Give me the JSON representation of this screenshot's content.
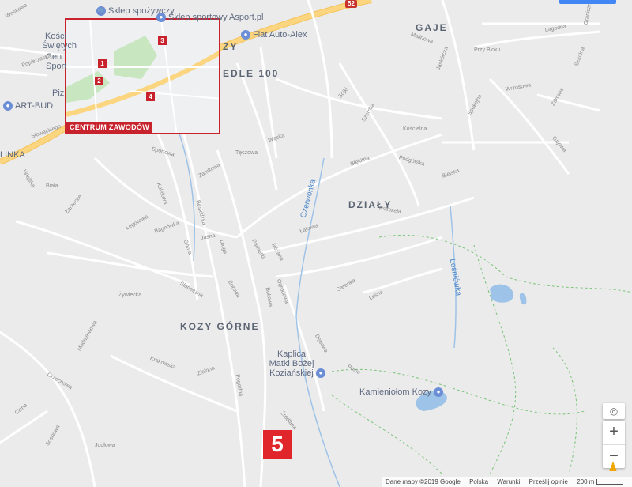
{
  "pois": [
    {
      "label": "Sklep spożywczy",
      "icon": "shopping-cart-icon"
    },
    {
      "label": "Sklep sportowy Asport.pl",
      "icon": "shopping-bag-icon"
    },
    {
      "label": "Fiat Auto-Alex",
      "icon": "car-icon"
    },
    {
      "label": "ART-BUD",
      "icon": "store-icon"
    },
    {
      "label": "Kaplica Matki Bożej Koziańskiej",
      "icon": "church-icon"
    },
    {
      "label": "Kamieniołom Kozy",
      "icon": "landmark-icon"
    }
  ],
  "partial_labels": {
    "kosc": "Kości",
    "swietych": "Świętych",
    "cen": "Cen",
    "sport": "Sport",
    "piz": "Piz",
    "linka": "LINKA",
    "zy": "ZY"
  },
  "areas": {
    "gaje": "GAJE",
    "osiedle": "EDLE 100",
    "dzialy": "DZIAŁY",
    "kozy_gorne": "KOZY GÓRNE"
  },
  "streams": {
    "czerwonka": "Czerwonka",
    "lesniowka": "Leśniówka"
  },
  "road_shield": "52",
  "streets": [
    "Woskowa",
    "Popierzaska",
    "Słowackiego",
    "Wiejska",
    "Biała",
    "Zarzecze",
    "Łęgowska",
    "Bagnówka",
    "Górna",
    "Słoneczna",
    "Sportowa",
    "Kolejowa",
    "Zamkowa",
    "Beskidzka",
    "Jasna",
    "Długa",
    "Wąska",
    "Tęczowa",
    "Pamiętki",
    "Różana",
    "Ogrodowa",
    "Bukowa",
    "Borowa",
    "Źródlana",
    "Leśna",
    "Sarenka",
    "Podgórska",
    "Błękitna",
    "Jaskółcza",
    "Lagodna",
    "Graniczna",
    "Zdrowia",
    "Spokojna",
    "Wrzosowa",
    "Malinowa",
    "Szeroka",
    "Przy Bloku",
    "Gajowa",
    "Sójki",
    "Łąkowa",
    "Pszczela",
    "Bielska",
    "Żywiecka",
    "Modrzewiowa",
    "Orzechowa",
    "Krakowska",
    "Zielona",
    "Pogodna",
    "Cicha",
    "Sosnowa",
    "Jodłowa",
    "Dębowa",
    "Polna",
    "Kościelna",
    "Szkolna"
  ],
  "inset": {
    "caption": "CENTRUM ZAWODÓW",
    "markers": [
      "1",
      "2",
      "3",
      "4"
    ]
  },
  "marker": "5",
  "controls": {
    "zoom_in": "+",
    "zoom_out": "−",
    "locate": "◎",
    "pegman": "♟"
  },
  "attribution": {
    "data": "Dane mapy ©2019 Google",
    "country": "Polska",
    "terms": "Warunki",
    "feedback": "Prześlij opinię",
    "scale": "200 m"
  },
  "colors": {
    "background": "#ebebeb",
    "road": "#ffffff",
    "main_road": "#fbd57f",
    "water": "#9ec3e8",
    "park": "#c8e6c0",
    "marker": "#e0262a",
    "trail": "#7ac47a"
  }
}
